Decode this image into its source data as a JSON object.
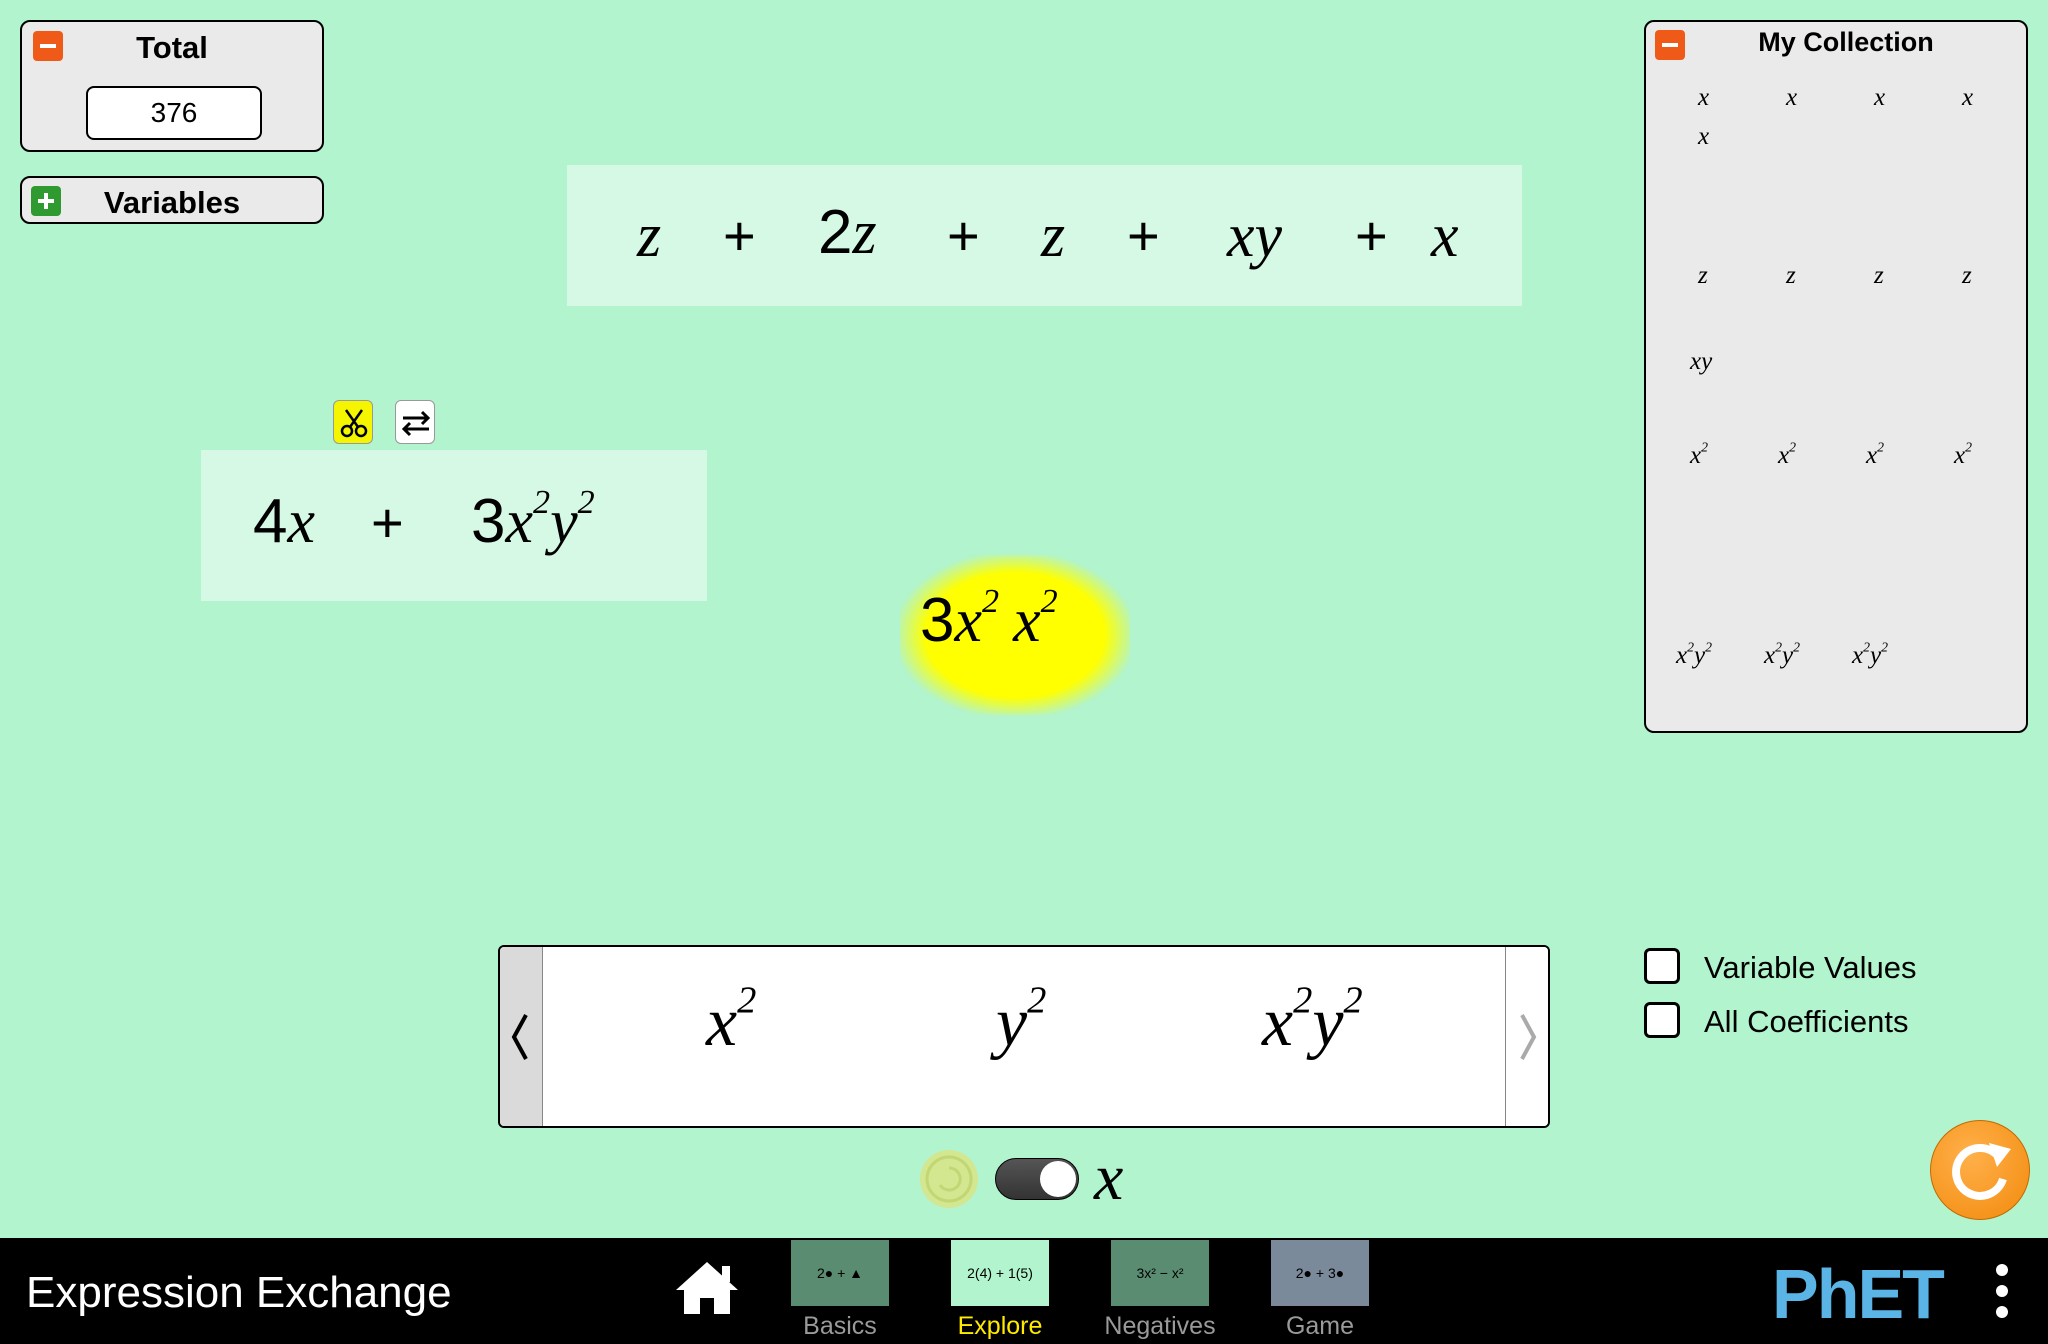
{
  "total_panel": {
    "title": "Total",
    "value": "376"
  },
  "variables_panel": {
    "title": "Variables"
  },
  "top_expression": {
    "terms": [
      "z",
      "2",
      "z",
      "z",
      "xy",
      "x"
    ],
    "op": "+"
  },
  "left_expression": {
    "coef1": "4",
    "var1": "x",
    "op": "+",
    "coef2": "3",
    "var2a": "x",
    "exp2a": "2",
    "var2b": "y",
    "exp2b": "2"
  },
  "floating_term": {
    "coef": "3",
    "var1": "x",
    "exp1": "2",
    "var2": "x",
    "exp2": "2"
  },
  "collection": {
    "title": "My Collection",
    "x_label": "x",
    "z_label": "z",
    "xy_label": "xy",
    "x2_var": "x",
    "x2_exp": "2",
    "x2y2_x": "x",
    "x2y2_y": "y",
    "x2y2_exp": "2"
  },
  "carousel": {
    "item1_var": "x",
    "item1_exp": "2",
    "item2_var": "y",
    "item2_exp": "2",
    "item3_var1": "x",
    "item3_exp1": "2",
    "item3_var2": "y",
    "item3_exp2": "2"
  },
  "checkboxes": {
    "variable_values": "Variable Values",
    "all_coefficients": "All Coefficients"
  },
  "toggle": {
    "label": "x"
  },
  "navbar": {
    "app_title": "Expression Exchange",
    "tabs": [
      {
        "label": "Basics",
        "thumb": "2● + ▲",
        "active": false
      },
      {
        "label": "Explore",
        "thumb": "2(4) + 1(5)",
        "active": true
      },
      {
        "label": "Negatives",
        "thumb": "3x² − x²",
        "active": false
      },
      {
        "label": "Game",
        "thumb": "2● + 3●",
        "active": false
      }
    ],
    "logo": "PhET"
  }
}
